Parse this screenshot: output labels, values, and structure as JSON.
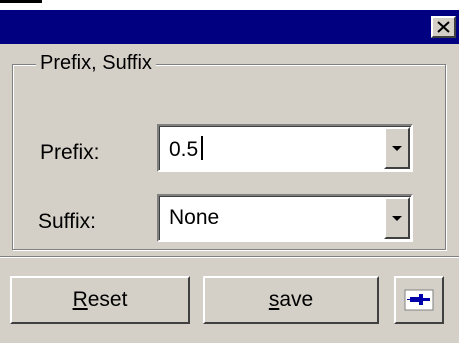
{
  "dialog": {
    "groupbox_title": "Prefix, Suffix",
    "prefix_label": "Prefix:",
    "prefix_value": "0.5",
    "suffix_label": "Suffix:",
    "suffix_value": "None",
    "reset_label_first": "R",
    "reset_label_rest": "eset",
    "save_label_first": "s",
    "save_label_rest": "ave"
  },
  "icons": {
    "close": "close-icon",
    "dropdown": "chevron-down-icon",
    "pin": "pushpin-icon"
  },
  "colors": {
    "titlebar": "#000080",
    "face": "#d4d0c8"
  }
}
